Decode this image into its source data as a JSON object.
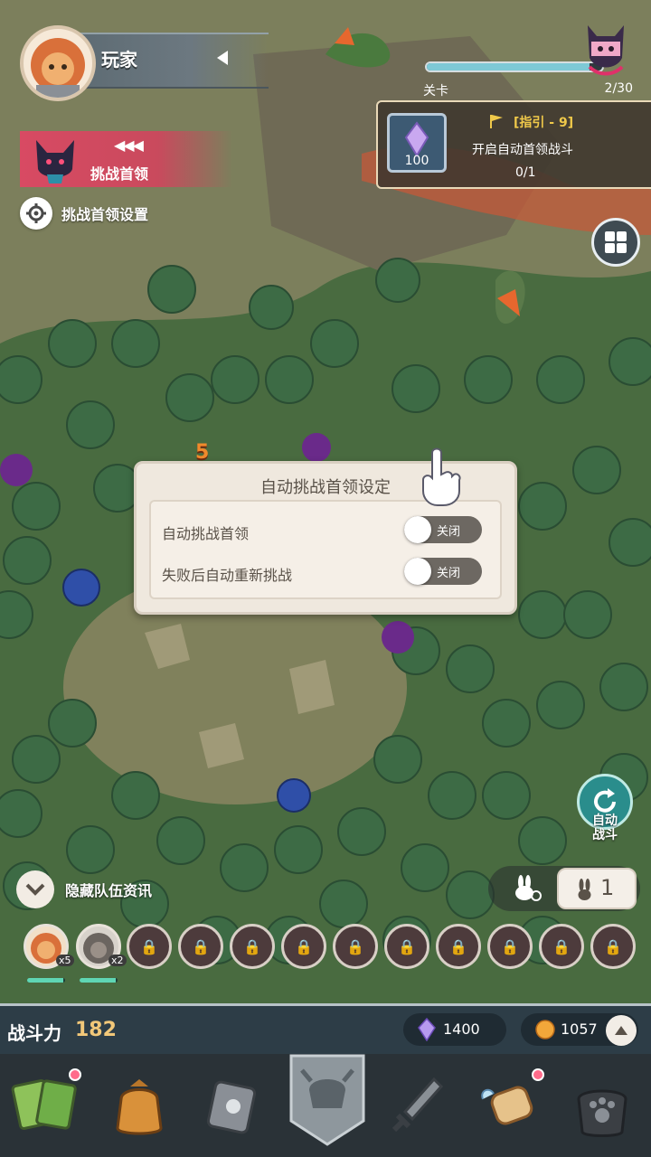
{
  "player": {
    "name": "玩家"
  },
  "boss_challenge": {
    "label": "挑战首领",
    "settings_label": "挑战首领设置"
  },
  "stage": {
    "label": "关卡",
    "count": "2/30",
    "progress": 0.93
  },
  "quest": {
    "title": "[指引 - 9]",
    "description": "开启自动首领战斗",
    "progress": "0/1",
    "reward_amount": "100"
  },
  "map": {
    "damage_number": "5"
  },
  "dialog": {
    "title": "自动挑战首领设定",
    "options": [
      {
        "label": "自动挑战首领",
        "toggle_label": "关闭"
      },
      {
        "label": "失败后自动重新挑战",
        "toggle_label": "关闭"
      }
    ]
  },
  "auto_battle": {
    "label_line1": "自动",
    "label_line2": "战斗"
  },
  "speed": {
    "value": "1"
  },
  "team": {
    "hide_label": "隐藏队伍资讯",
    "heroes": [
      {
        "count": "x5",
        "hp": 0.95
      },
      {
        "count": "x2",
        "hp": 0.95
      }
    ]
  },
  "stats": {
    "power_label": "战斗力",
    "power_value": "182",
    "gems": "1400",
    "coins": "1057"
  },
  "colors": {
    "accent_red": "#d84a63",
    "gold": "#f2c879",
    "teal": "#2a8d8c"
  },
  "nav": {
    "icons": [
      "cards-icon",
      "bag-icon",
      "wrench-book-icon",
      "helmet-icon",
      "sword-icon",
      "scroll-icon",
      "pawprint-bag-icon"
    ]
  }
}
